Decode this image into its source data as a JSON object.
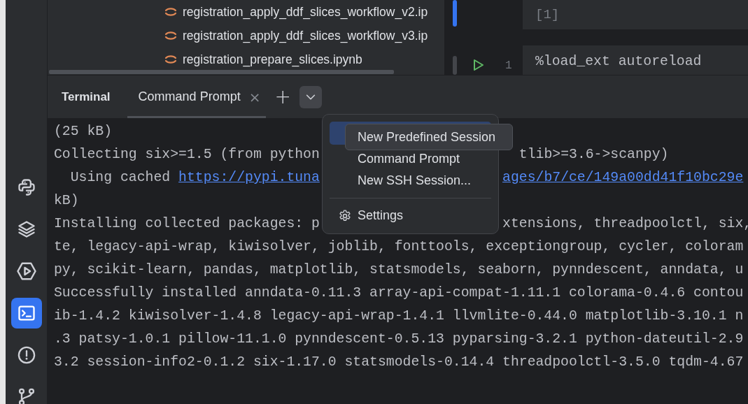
{
  "sidebar": {
    "items": [
      {
        "kind": "python",
        "selected": false
      },
      {
        "kind": "layers",
        "selected": false
      },
      {
        "kind": "services",
        "selected": false
      },
      {
        "kind": "terminal",
        "selected": true
      },
      {
        "kind": "problems",
        "selected": false
      },
      {
        "kind": "git",
        "selected": false
      }
    ]
  },
  "project_tree": {
    "files": [
      {
        "name": "registration_apply_ddf_slices_workflow_v2.ip"
      },
      {
        "name": "registration_apply_ddf_slices_workflow_v3.ip"
      },
      {
        "name": "registration_prepare_slices.ipynb"
      }
    ]
  },
  "editor": {
    "execution_count": "[1]",
    "line_number": "1",
    "code": "%load_ext autoreload"
  },
  "terminal": {
    "title": "Terminal",
    "tabs": [
      {
        "label": "Command Prompt",
        "selected": true
      }
    ],
    "close_glyph": "×",
    "new_tab_glyph": "+",
    "lines": [
      {
        "left": [
          {
            "kind": "plain",
            "text": "(25 kB)"
          }
        ]
      },
      {
        "left": [
          {
            "kind": "plain",
            "text": "Collecting six>=1.5 (from python"
          }
        ],
        "right": [
          {
            "kind": "plain",
            "text": "tlib>=3.6->scanpy)"
          }
        ]
      },
      {
        "left": [
          {
            "kind": "plain",
            "text": "  Using cached "
          },
          {
            "kind": "link",
            "text": "https://pypi.tuna"
          }
        ],
        "right": [
          {
            "kind": "link",
            "text": "ages/b7/ce/149a00dd41f10bc29e"
          }
        ]
      },
      {
        "left": [
          {
            "kind": "plain",
            "text": "kB)"
          }
        ]
      },
      {
        "left": [
          {
            "kind": "plain",
            "text": "Installing collected packages: p"
          }
        ],
        "right": [
          {
            "kind": "plain",
            "text": "xtensions, threadpoolctl, six,"
          }
        ]
      },
      {
        "left": [
          {
            "kind": "plain",
            "text": "te, legacy-api-wrap, kiwisolver, joblib, fonttools, exceptiongroup, cycler, coloram"
          }
        ]
      },
      {
        "left": [
          {
            "kind": "plain",
            "text": "py, scikit-learn, pandas, matplotlib, statsmodels, seaborn, pynndescent, anndata, u"
          }
        ]
      },
      {
        "left": [
          {
            "kind": "plain",
            "text": "Successfully installed anndata-0.11.3 array-api-compat-1.11.1 colorama-0.4.6 contou"
          }
        ]
      },
      {
        "left": [
          {
            "kind": "plain",
            "text": "ib-1.4.2 kiwisolver-1.4.8 legacy-api-wrap-1.4.1 llvmlite-0.44.0 matplotlib-3.10.1 n"
          }
        ]
      },
      {
        "left": [
          {
            "kind": "plain",
            "text": ".3 patsy-1.0.1 pillow-11.1.0 pynndescent-0.5.13 pyparsing-3.2.1 python-dateutil-2.9"
          }
        ]
      },
      {
        "left": [
          {
            "kind": "plain",
            "text": "3.2 session-info2-0.1.2 six-1.17.0 statsmodels-0.14.4 threadpoolctl-3.5.0 tqdm-4.67"
          }
        ]
      }
    ]
  },
  "session_menu": {
    "items": [
      {
        "kind": "item",
        "selected": true
      },
      {
        "kind": "item",
        "label": "Command Prompt",
        "selected": false
      },
      {
        "kind": "item",
        "label": "New SSH Session...",
        "selected": false
      },
      {
        "kind": "separator"
      },
      {
        "kind": "settings",
        "label": "Settings",
        "selected": false
      }
    ],
    "tooltip": "New Predefined Session"
  }
}
